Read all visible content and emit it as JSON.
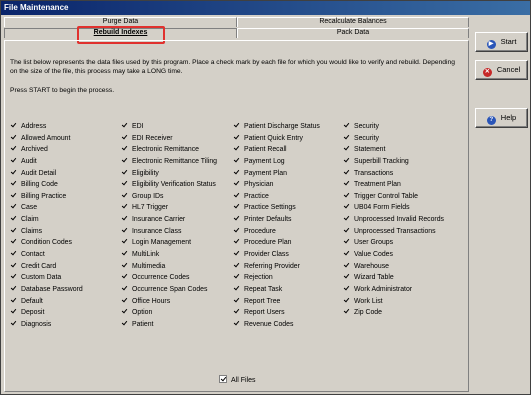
{
  "window": {
    "title": "File Maintenance"
  },
  "tabs": {
    "back": [
      "Purge Data",
      "Recalculate Balances"
    ],
    "front": [
      "Rebuild Indexes",
      "Pack Data"
    ],
    "active": "Rebuild Indexes"
  },
  "description": "The list below represents the data files used by this program.  Place a check mark by each file for which you would like to verify and rebuild. Depending on the size of the file, this process may take a LONG time.",
  "instruction": "Press START to begin the process.",
  "columns": [
    [
      "Address",
      "Allowed Amount",
      "Archived",
      "Audit",
      "Audit Detail",
      "Billing Code",
      "Billing Practice",
      "Case",
      "Claim",
      "Claims",
      "Condition Codes",
      "Contact",
      "Credit Card",
      "Custom Data",
      "Database Password",
      "Default",
      "Deposit",
      "Diagnosis"
    ],
    [
      "EDI",
      "EDI Receiver",
      "Electronic Remittance",
      "Electronic Remittance Tiling",
      "Eligibility",
      "Eligibility Verification Status",
      "Group IDs",
      "HL7 Trigger",
      "Insurance Carrier",
      "Insurance Class",
      "Login Management",
      "MultiLink",
      "Multimedia",
      "Occurrence Codes",
      "Occurrence Span Codes",
      "Office Hours",
      "Option",
      "Patient"
    ],
    [
      "Patient Discharge Status",
      "Patient Quick Entry",
      "Patient Recall",
      "Payment Log",
      "Payment Plan",
      "Physician",
      "Practice",
      "Practice Settings",
      "Printer Defaults",
      "Procedure",
      "Procedure Plan",
      "Provider Class",
      "Referring Provider",
      "Rejection",
      "Repeat Task",
      "Report Tree",
      "Report Users",
      "Revenue Codes"
    ],
    [
      "Security",
      "Security",
      "Statement",
      "Superbill Tracking",
      "Transactions",
      "Treatment Plan",
      "Trigger Control Table",
      "UB04 Form Fields",
      "Unprocessed Invalid Records",
      "Unprocessed Transactions",
      "User Groups",
      "Value Codes",
      "Warehouse",
      "Wizard Table",
      "Work Administrator",
      "Work List",
      "Zip Code"
    ]
  ],
  "all_files_label": "All Files",
  "buttons": {
    "start": "Start",
    "cancel": "Cancel",
    "help": "Help"
  }
}
